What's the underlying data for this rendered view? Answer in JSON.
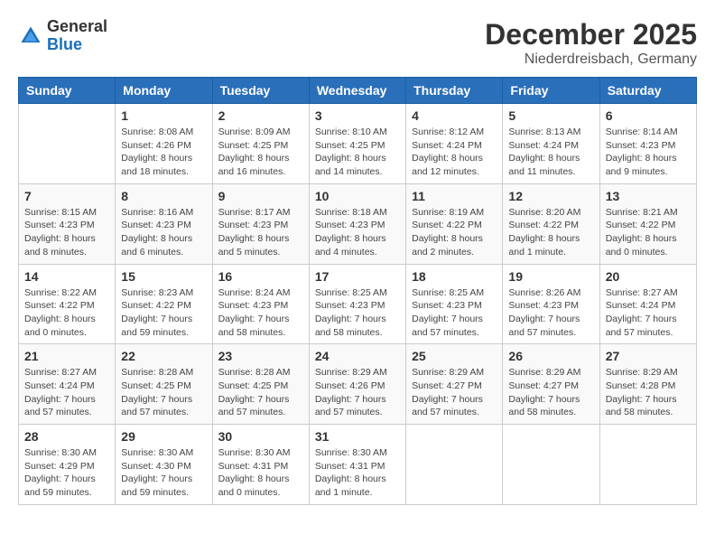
{
  "header": {
    "logo_general": "General",
    "logo_blue": "Blue",
    "month": "December 2025",
    "location": "Niederdreisbach, Germany"
  },
  "weekdays": [
    "Sunday",
    "Monday",
    "Tuesday",
    "Wednesday",
    "Thursday",
    "Friday",
    "Saturday"
  ],
  "weeks": [
    [
      {
        "day": "",
        "sunrise": "",
        "sunset": "",
        "daylight": ""
      },
      {
        "day": "1",
        "sunrise": "Sunrise: 8:08 AM",
        "sunset": "Sunset: 4:26 PM",
        "daylight": "Daylight: 8 hours and 18 minutes."
      },
      {
        "day": "2",
        "sunrise": "Sunrise: 8:09 AM",
        "sunset": "Sunset: 4:25 PM",
        "daylight": "Daylight: 8 hours and 16 minutes."
      },
      {
        "day": "3",
        "sunrise": "Sunrise: 8:10 AM",
        "sunset": "Sunset: 4:25 PM",
        "daylight": "Daylight: 8 hours and 14 minutes."
      },
      {
        "day": "4",
        "sunrise": "Sunrise: 8:12 AM",
        "sunset": "Sunset: 4:24 PM",
        "daylight": "Daylight: 8 hours and 12 minutes."
      },
      {
        "day": "5",
        "sunrise": "Sunrise: 8:13 AM",
        "sunset": "Sunset: 4:24 PM",
        "daylight": "Daylight: 8 hours and 11 minutes."
      },
      {
        "day": "6",
        "sunrise": "Sunrise: 8:14 AM",
        "sunset": "Sunset: 4:23 PM",
        "daylight": "Daylight: 8 hours and 9 minutes."
      }
    ],
    [
      {
        "day": "7",
        "sunrise": "Sunrise: 8:15 AM",
        "sunset": "Sunset: 4:23 PM",
        "daylight": "Daylight: 8 hours and 8 minutes."
      },
      {
        "day": "8",
        "sunrise": "Sunrise: 8:16 AM",
        "sunset": "Sunset: 4:23 PM",
        "daylight": "Daylight: 8 hours and 6 minutes."
      },
      {
        "day": "9",
        "sunrise": "Sunrise: 8:17 AM",
        "sunset": "Sunset: 4:23 PM",
        "daylight": "Daylight: 8 hours and 5 minutes."
      },
      {
        "day": "10",
        "sunrise": "Sunrise: 8:18 AM",
        "sunset": "Sunset: 4:23 PM",
        "daylight": "Daylight: 8 hours and 4 minutes."
      },
      {
        "day": "11",
        "sunrise": "Sunrise: 8:19 AM",
        "sunset": "Sunset: 4:22 PM",
        "daylight": "Daylight: 8 hours and 2 minutes."
      },
      {
        "day": "12",
        "sunrise": "Sunrise: 8:20 AM",
        "sunset": "Sunset: 4:22 PM",
        "daylight": "Daylight: 8 hours and 1 minute."
      },
      {
        "day": "13",
        "sunrise": "Sunrise: 8:21 AM",
        "sunset": "Sunset: 4:22 PM",
        "daylight": "Daylight: 8 hours and 0 minutes."
      }
    ],
    [
      {
        "day": "14",
        "sunrise": "Sunrise: 8:22 AM",
        "sunset": "Sunset: 4:22 PM",
        "daylight": "Daylight: 8 hours and 0 minutes."
      },
      {
        "day": "15",
        "sunrise": "Sunrise: 8:23 AM",
        "sunset": "Sunset: 4:22 PM",
        "daylight": "Daylight: 7 hours and 59 minutes."
      },
      {
        "day": "16",
        "sunrise": "Sunrise: 8:24 AM",
        "sunset": "Sunset: 4:23 PM",
        "daylight": "Daylight: 7 hours and 58 minutes."
      },
      {
        "day": "17",
        "sunrise": "Sunrise: 8:25 AM",
        "sunset": "Sunset: 4:23 PM",
        "daylight": "Daylight: 7 hours and 58 minutes."
      },
      {
        "day": "18",
        "sunrise": "Sunrise: 8:25 AM",
        "sunset": "Sunset: 4:23 PM",
        "daylight": "Daylight: 7 hours and 57 minutes."
      },
      {
        "day": "19",
        "sunrise": "Sunrise: 8:26 AM",
        "sunset": "Sunset: 4:23 PM",
        "daylight": "Daylight: 7 hours and 57 minutes."
      },
      {
        "day": "20",
        "sunrise": "Sunrise: 8:27 AM",
        "sunset": "Sunset: 4:24 PM",
        "daylight": "Daylight: 7 hours and 57 minutes."
      }
    ],
    [
      {
        "day": "21",
        "sunrise": "Sunrise: 8:27 AM",
        "sunset": "Sunset: 4:24 PM",
        "daylight": "Daylight: 7 hours and 57 minutes."
      },
      {
        "day": "22",
        "sunrise": "Sunrise: 8:28 AM",
        "sunset": "Sunset: 4:25 PM",
        "daylight": "Daylight: 7 hours and 57 minutes."
      },
      {
        "day": "23",
        "sunrise": "Sunrise: 8:28 AM",
        "sunset": "Sunset: 4:25 PM",
        "daylight": "Daylight: 7 hours and 57 minutes."
      },
      {
        "day": "24",
        "sunrise": "Sunrise: 8:29 AM",
        "sunset": "Sunset: 4:26 PM",
        "daylight": "Daylight: 7 hours and 57 minutes."
      },
      {
        "day": "25",
        "sunrise": "Sunrise: 8:29 AM",
        "sunset": "Sunset: 4:27 PM",
        "daylight": "Daylight: 7 hours and 57 minutes."
      },
      {
        "day": "26",
        "sunrise": "Sunrise: 8:29 AM",
        "sunset": "Sunset: 4:27 PM",
        "daylight": "Daylight: 7 hours and 58 minutes."
      },
      {
        "day": "27",
        "sunrise": "Sunrise: 8:29 AM",
        "sunset": "Sunset: 4:28 PM",
        "daylight": "Daylight: 7 hours and 58 minutes."
      }
    ],
    [
      {
        "day": "28",
        "sunrise": "Sunrise: 8:30 AM",
        "sunset": "Sunset: 4:29 PM",
        "daylight": "Daylight: 7 hours and 59 minutes."
      },
      {
        "day": "29",
        "sunrise": "Sunrise: 8:30 AM",
        "sunset": "Sunset: 4:30 PM",
        "daylight": "Daylight: 7 hours and 59 minutes."
      },
      {
        "day": "30",
        "sunrise": "Sunrise: 8:30 AM",
        "sunset": "Sunset: 4:31 PM",
        "daylight": "Daylight: 8 hours and 0 minutes."
      },
      {
        "day": "31",
        "sunrise": "Sunrise: 8:30 AM",
        "sunset": "Sunset: 4:31 PM",
        "daylight": "Daylight: 8 hours and 1 minute."
      },
      {
        "day": "",
        "sunrise": "",
        "sunset": "",
        "daylight": ""
      },
      {
        "day": "",
        "sunrise": "",
        "sunset": "",
        "daylight": ""
      },
      {
        "day": "",
        "sunrise": "",
        "sunset": "",
        "daylight": ""
      }
    ]
  ]
}
